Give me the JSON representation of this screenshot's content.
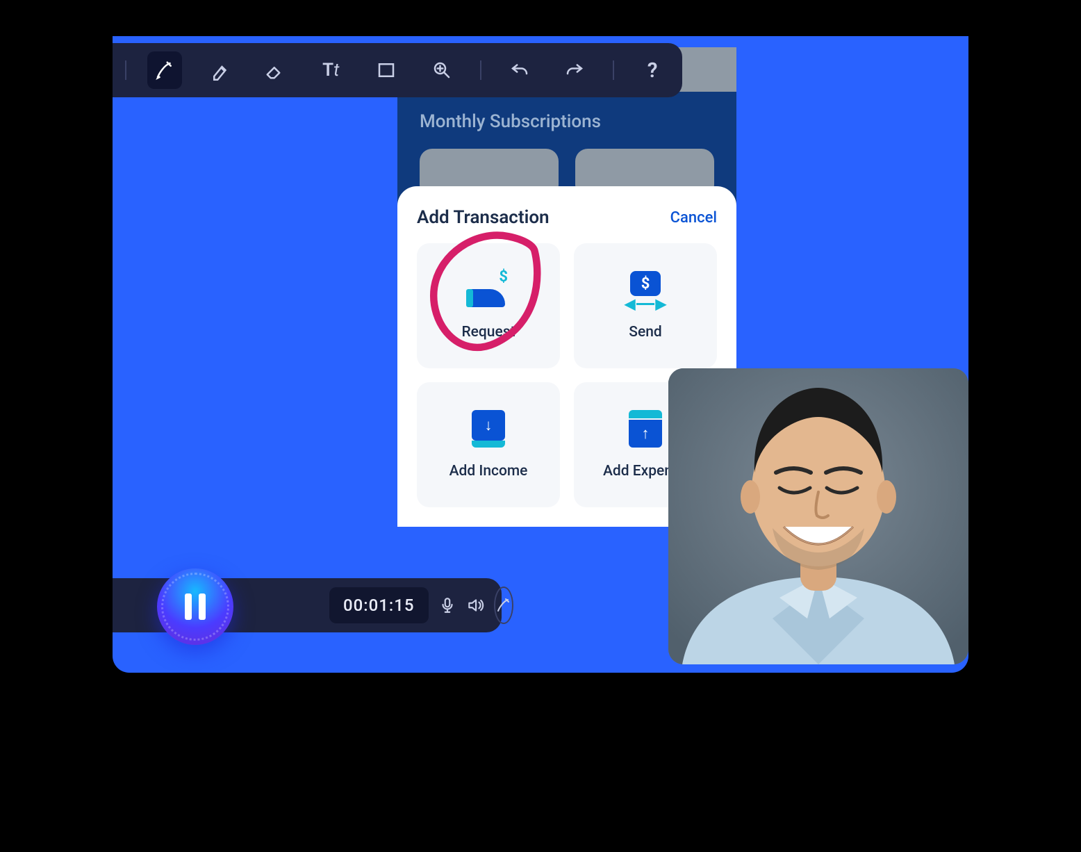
{
  "toolbar": {
    "tools": [
      "pen",
      "highlighter",
      "eraser",
      "text",
      "rectangle",
      "zoom"
    ],
    "actions": [
      "undo",
      "redo",
      "help"
    ]
  },
  "app": {
    "section_title": "Monthly Subscriptions",
    "sheet": {
      "title": "Add Transaction",
      "cancel": "Cancel",
      "tiles": [
        {
          "label": "Request"
        },
        {
          "label": "Send"
        },
        {
          "label": "Add Income"
        },
        {
          "label": "Add Expense"
        }
      ]
    }
  },
  "recorder": {
    "timer": "00:01:15",
    "state": "recording"
  },
  "webcam": {
    "present": true
  }
}
